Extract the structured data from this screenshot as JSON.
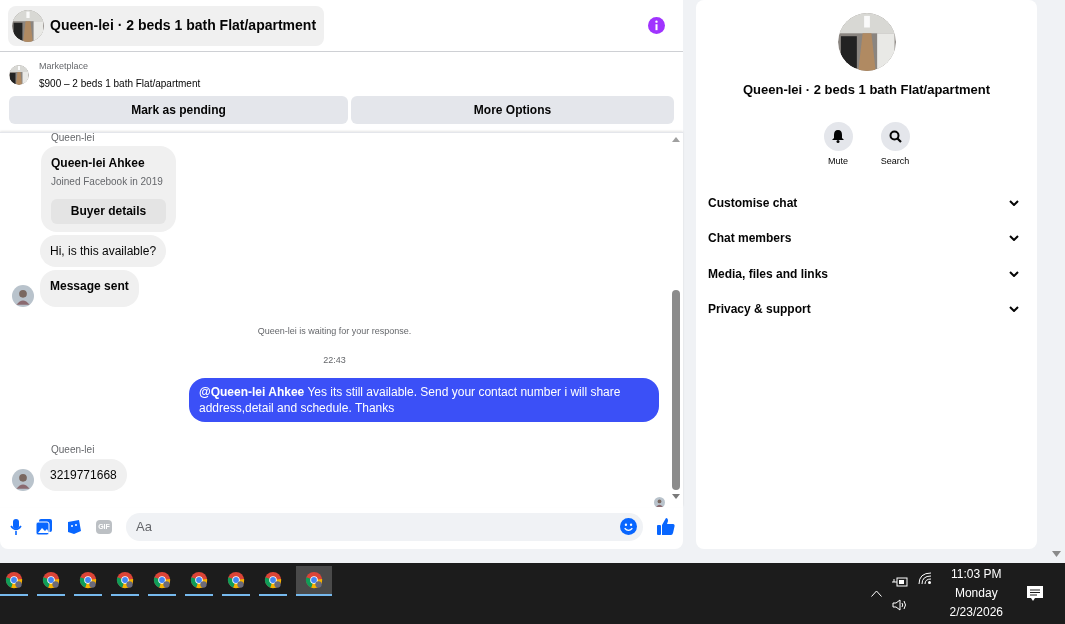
{
  "chat": {
    "title": "Queen-lei · 2 beds 1 bath Flat/apartment",
    "listing": {
      "label": "Marketplace",
      "title": "$900 – 2 beds 1 bath Flat/apartment"
    },
    "buttons": [
      "Mark as pending",
      "More Options"
    ],
    "messages": [
      {
        "kind": "sender",
        "text": "Queen-lei"
      },
      {
        "kind": "card",
        "name": "Queen-lei Ahkee",
        "subtitle": "Joined Facebook in 2019",
        "button": "Buyer details"
      },
      {
        "kind": "incoming",
        "text": "Hi, is this available?",
        "avatar": false
      },
      {
        "kind": "incoming",
        "text": "Message sent",
        "avatar": true
      },
      {
        "kind": "status",
        "text": "Queen-lei is waiting for your response."
      },
      {
        "kind": "time",
        "text": "22:43"
      },
      {
        "kind": "outgoing",
        "text": "**@Queen-lei Ahkee**  Yes its still available. Send your contact number i will share address,detail and schedule. Thanks"
      },
      {
        "kind": "sender",
        "text": "Queen-lei"
      },
      {
        "kind": "incoming",
        "text": "3219771668",
        "avatar": true
      }
    ],
    "composer": {
      "gif": "GIF",
      "placeholder": "Aa"
    }
  },
  "details": {
    "title": "Queen-lei · 2 beds 1 bath Flat/apartment",
    "actions": [
      {
        "kind": "mute",
        "label": "Mute"
      },
      {
        "kind": "search",
        "label": "Search"
      }
    ],
    "sections": [
      {
        "label": "Customise chat",
        "expanded": false
      },
      {
        "label": "Chat members",
        "expanded": false
      },
      {
        "label": "Media, files and links",
        "expanded": false
      },
      {
        "label": "Privacy & support",
        "expanded": false
      }
    ]
  },
  "taskbar": {
    "apps": [
      {
        "selected": false
      },
      {
        "selected": false
      },
      {
        "selected": false
      },
      {
        "selected": false
      },
      {
        "selected": false
      },
      {
        "selected": false
      },
      {
        "selected": false
      },
      {
        "selected": false
      },
      {
        "selected": true
      }
    ],
    "time": "11:03 PM",
    "day": "Monday",
    "date": "2/23/2026"
  }
}
